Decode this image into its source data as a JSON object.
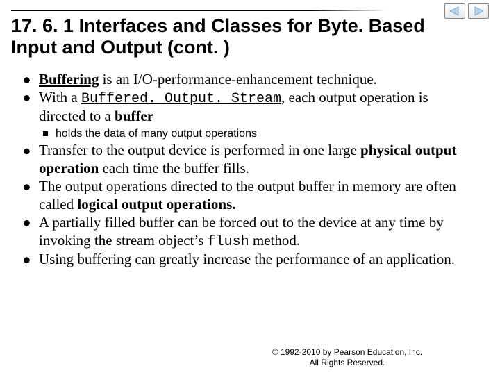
{
  "title": "17. 6. 1 Interfaces and Classes for Byte. Based Input and Output (cont. )",
  "nav": {
    "prev_icon": "left-triangle",
    "next_icon": "right-triangle"
  },
  "bullets": {
    "b1": {
      "part1": "Buffering",
      "part2": " is an I/O-performance-enhancement technique."
    },
    "b2": {
      "part1": "With a ",
      "code": "Buffered. Output. Stream",
      "part2": ", each output operation is directed to a ",
      "bold": "buffer"
    },
    "b2_sub1": "holds the data of many output operations",
    "b3": {
      "part1": "Transfer to the output device is performed in one large ",
      "bold": "physical output operation",
      "part2": " each time the buffer fills."
    },
    "b4": {
      "part1": "The output operations directed to the output buffer in memory are often called ",
      "bold": "logical output operations."
    },
    "b5": {
      "part1": "A partially filled buffer can be forced out to the device at any time by invoking the stream object’s ",
      "code": "flush",
      "part2": " method."
    },
    "b6": "Using buffering can greatly increase the performance of an application."
  },
  "footer": {
    "line1": "© 1992-2010 by Pearson Education, Inc.",
    "line2": "All Rights Reserved."
  }
}
